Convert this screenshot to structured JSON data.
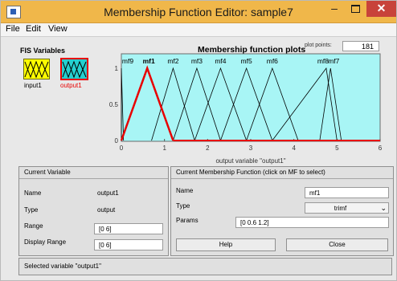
{
  "window": {
    "title": "Membership Function Editor: sample7"
  },
  "window_controls": {
    "minimize": "–",
    "close": "✕"
  },
  "menu": {
    "items": [
      "File",
      "Edit",
      "View"
    ]
  },
  "fis": {
    "heading": "FIS Variables",
    "input_label": "input1",
    "output_label": "output1",
    "input_color": "#ffff00",
    "output_color": "#25d0d0",
    "selected_border": "#e80000"
  },
  "plot": {
    "title": "Membership function plots",
    "points_label": "plot points:",
    "points_value": "181",
    "xlabel": "output variable \"output1\"",
    "x_ticks": [
      "0",
      "1",
      "2",
      "3",
      "4",
      "5",
      "6"
    ],
    "y_ticks": [
      "0",
      "0.5",
      "1"
    ],
    "mf_labels": [
      "mf9",
      "mf1",
      "mf2",
      "mf3",
      "mf4",
      "mf5",
      "mf6",
      "mf8",
      "mf7"
    ],
    "background": "#a8f5f5",
    "highlight_color": "#e80000"
  },
  "chart_data": {
    "type": "line",
    "title": "Membership function plots",
    "xlabel": "output variable \"output1\"",
    "ylabel": "",
    "xlim": [
      0,
      6
    ],
    "ylim": [
      0,
      1
    ],
    "series": [
      {
        "name": "mf9",
        "points": [
          [
            0,
            0
          ],
          [
            0,
            1
          ],
          [
            0.05,
            0
          ]
        ]
      },
      {
        "name": "mf1",
        "points": [
          [
            0,
            0
          ],
          [
            0.6,
            1
          ],
          [
            1.2,
            0
          ]
        ],
        "highlighted": true
      },
      {
        "name": "mf2",
        "points": [
          [
            0.7,
            0
          ],
          [
            1.2,
            1
          ],
          [
            1.7,
            0
          ]
        ]
      },
      {
        "name": "mf3",
        "points": [
          [
            1.2,
            0
          ],
          [
            1.75,
            1
          ],
          [
            2.3,
            0
          ]
        ]
      },
      {
        "name": "mf4",
        "points": [
          [
            1.7,
            0
          ],
          [
            2.3,
            1
          ],
          [
            2.9,
            0
          ]
        ]
      },
      {
        "name": "mf5",
        "points": [
          [
            2.3,
            0
          ],
          [
            2.9,
            1
          ],
          [
            3.5,
            0
          ]
        ]
      },
      {
        "name": "mf6",
        "points": [
          [
            2.9,
            0
          ],
          [
            3.5,
            1
          ],
          [
            4.1,
            0
          ]
        ]
      },
      {
        "name": "mf8",
        "points": [
          [
            3.5,
            0
          ],
          [
            4.75,
            1
          ],
          [
            5.0,
            0
          ]
        ]
      },
      {
        "name": "mf7",
        "points": [
          [
            4.6,
            0
          ],
          [
            4.85,
            1
          ],
          [
            5.1,
            0
          ]
        ]
      }
    ]
  },
  "current_variable": {
    "header": "Current Variable",
    "name_label": "Name",
    "name_value": "output1",
    "type_label": "Type",
    "type_value": "output",
    "range_label": "Range",
    "range_value": "[0 6]",
    "display_range_label": "Display Range",
    "display_range_value": "[0 6]"
  },
  "current_mf": {
    "header": "Current Membership Function (click on MF to select)",
    "name_label": "Name",
    "name_value": "mf1",
    "type_label": "Type",
    "type_value": "trimf",
    "params_label": "Params",
    "params_value": "[0 0.6 1.2]"
  },
  "buttons": {
    "help": "Help",
    "close": "Close"
  },
  "status": {
    "text": "Selected variable \"output1\""
  }
}
